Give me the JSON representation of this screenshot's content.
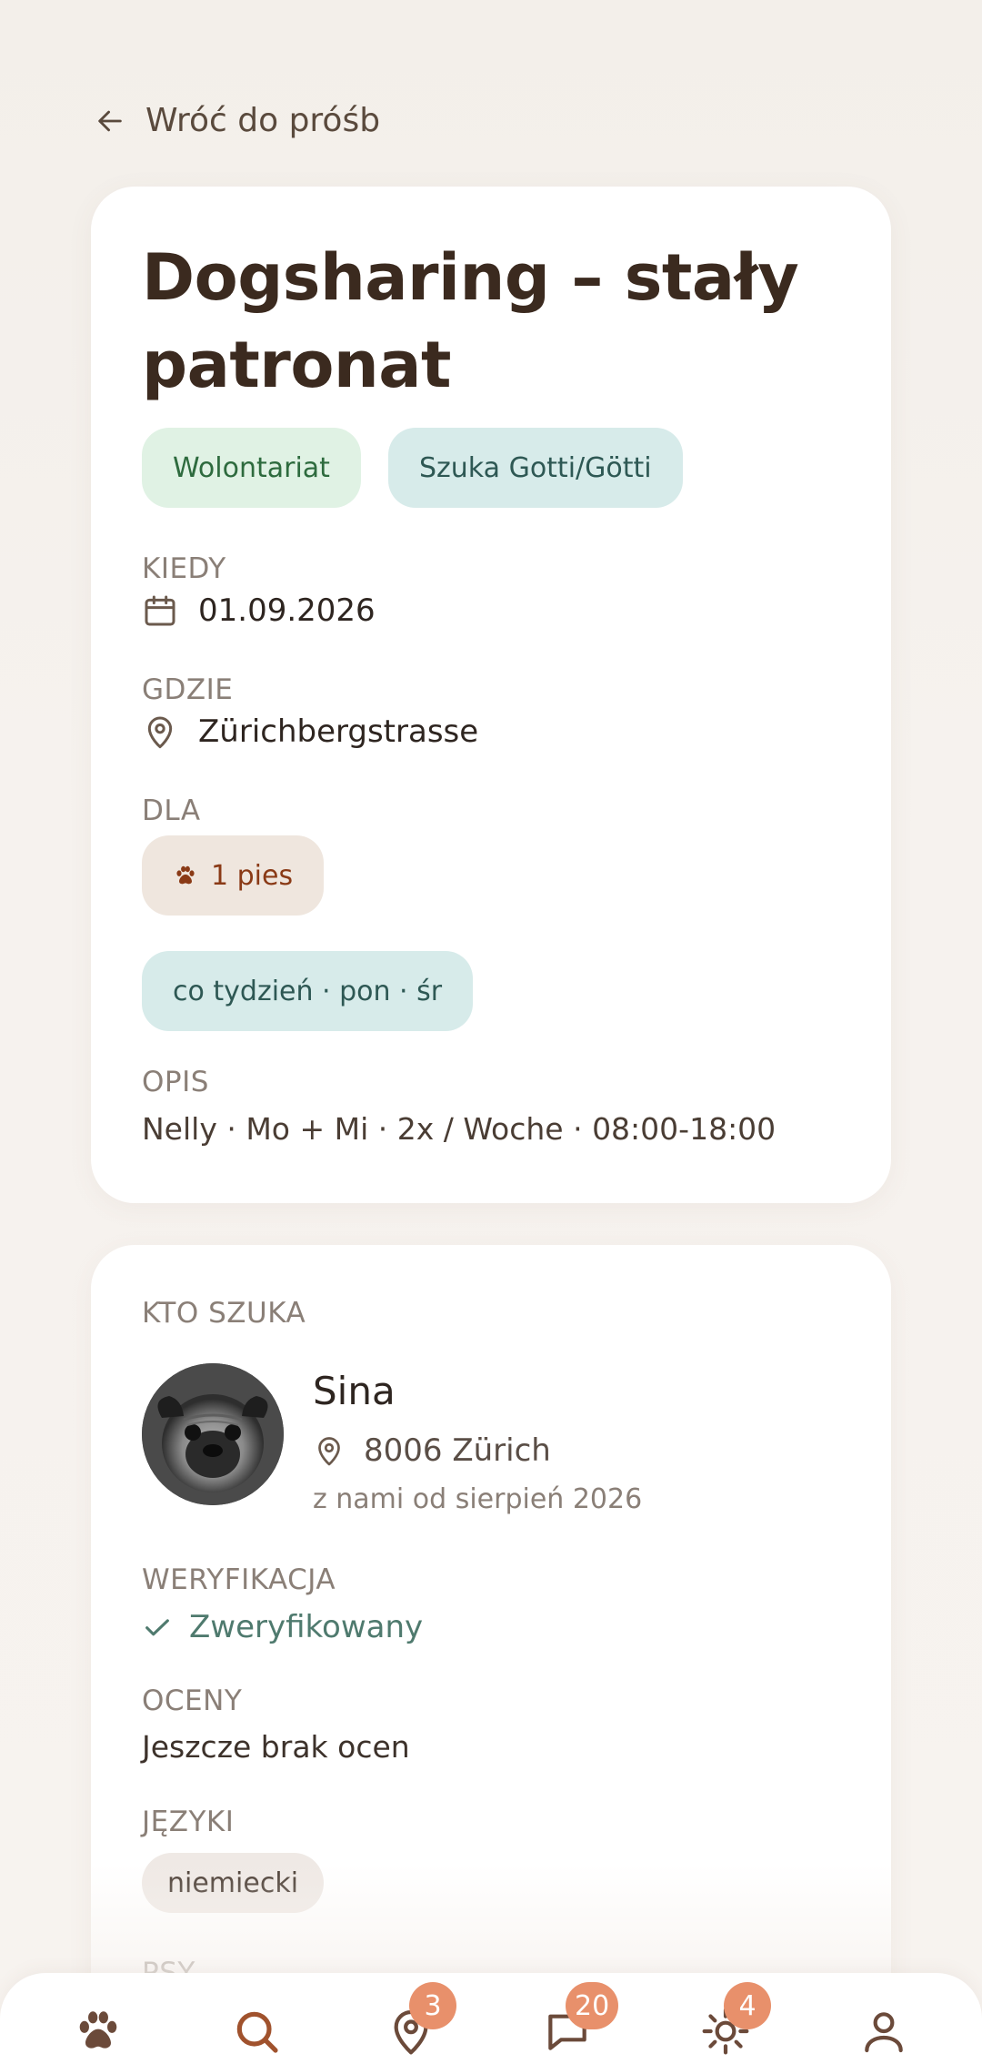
{
  "back": {
    "label": "Wróć do próśb"
  },
  "request": {
    "title": "Dogsharing – stały patronat",
    "tags": [
      "Wolontariat",
      "Szuka Gotti/Götti"
    ],
    "when_label": "KIEDY",
    "when_value": "01.09.2026",
    "where_label": "GDZIE",
    "where_value": "Zürichbergstrasse",
    "for_label": "DLA",
    "for_value": "1 pies",
    "schedule": "co tydzień · pon · śr",
    "desc_label": "OPIS",
    "desc_value": "Nelly · Mo + Mi · 2x / Woche · 08:00-18:00"
  },
  "requester": {
    "section_label": "KTO SZUKA",
    "name": "Sina",
    "location": "8006 Zürich",
    "since": "z nami od sierpień 2026",
    "verification_label": "WERYFIKACJA",
    "verification_value": "Zweryfikowany",
    "ratings_label": "OCENY",
    "ratings_value": "Jeszcze brak ocen",
    "languages_label": "JĘZYKI",
    "languages": [
      "niemiecki"
    ],
    "dogs_label": "PSY"
  },
  "nav": {
    "items": [
      {
        "icon": "paw-icon",
        "badge": ""
      },
      {
        "icon": "search-icon",
        "badge": ""
      },
      {
        "icon": "map-pin-icon",
        "badge": "3"
      },
      {
        "icon": "chat-icon",
        "badge": "20"
      },
      {
        "icon": "sun-icon",
        "badge": "4"
      },
      {
        "icon": "profile-icon",
        "badge": ""
      }
    ]
  },
  "colors": {
    "accent": "#e8906b",
    "title": "#3b2a1f",
    "tag_green_bg": "#e0f2e4",
    "tag_teal_bg": "#d7ebea",
    "tag_beige_bg": "#efe6de"
  }
}
